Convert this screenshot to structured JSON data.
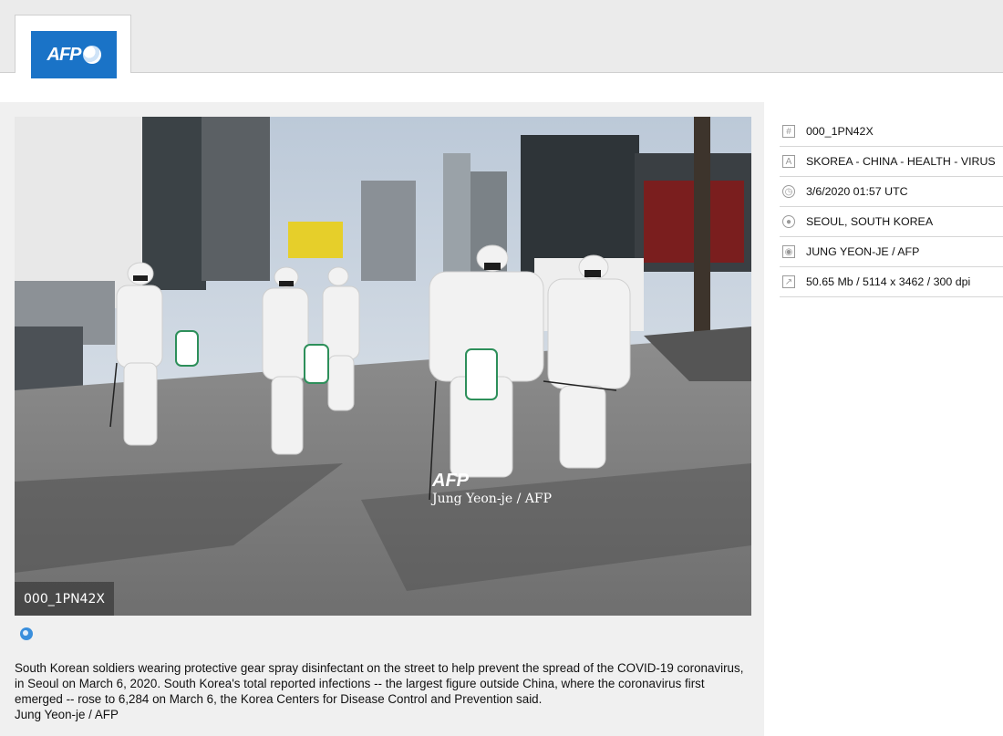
{
  "header": {
    "logo": {
      "text": "AFP",
      "icon": "afp-globe-logo",
      "color": "#1a73c7"
    }
  },
  "photo": {
    "id_overlay": "000_1PN42X",
    "watermark_logo": "AFP",
    "watermark_credit": "Jung Yeon-je / AFP"
  },
  "caption": {
    "text": "South Korean soldiers wearing protective gear spray disinfectant on the street to help prevent the spread of the COVID-19 coronavirus, in Seoul on March 6, 2020. South Korea's total reported infections -- the largest figure outside China, where the coronavirus first emerged -- rose to 6,284 on March 6, the Korea Centers for Disease Control and Prevention said.",
    "credit": "Jung Yeon-je / AFP"
  },
  "meta": {
    "id": {
      "icon": "document-id-icon",
      "value": "000_1PN42X"
    },
    "title": {
      "icon": "text-a-icon",
      "value": "SKOREA - CHINA - HEALTH - VIRUS"
    },
    "date": {
      "icon": "clock-icon",
      "value": "3/6/2020 01:57 UTC"
    },
    "location": {
      "icon": "globe-icon",
      "value": "SEOUL, SOUTH KOREA"
    },
    "photographer": {
      "icon": "camera-icon",
      "value": "JUNG YEON-JE / AFP"
    },
    "file": {
      "icon": "resize-icon",
      "value": "50.65 Mb / 5114 x 3462 / 300 dpi"
    }
  },
  "colors": {
    "accent": "#1a73c7",
    "panel": "#f0f0f0",
    "topbar": "#ebebeb"
  }
}
